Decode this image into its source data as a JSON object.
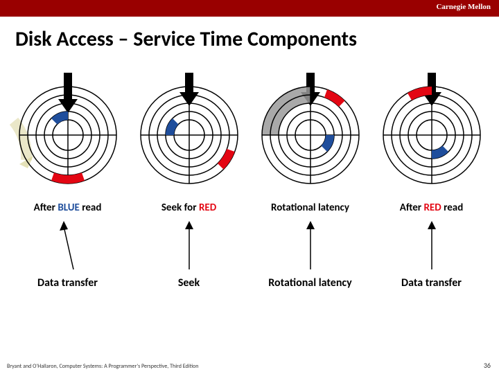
{
  "header": {
    "org": "Carnegie Mellon"
  },
  "title": "Disk Access – Service Time Components",
  "stages": [
    {
      "label_pre": "After ",
      "label_color": "BLUE",
      "label_post": " read",
      "color_class": "blue",
      "bottom": "Data transfer"
    },
    {
      "label_pre": "Seek for ",
      "label_color": "RED",
      "label_post": "",
      "color_class": "red",
      "bottom": "Seek"
    },
    {
      "label_pre": "Rotational latency",
      "label_color": "",
      "label_post": "",
      "color_class": "",
      "bottom": "Rotational latency"
    },
    {
      "label_pre": "After ",
      "label_color": "RED",
      "label_post": " read",
      "color_class": "red",
      "bottom": "Data transfer"
    }
  ],
  "footer": "Bryant and O'Hallaron, Computer Systems: A Programmer's Perspective, Third Edition",
  "page": "36"
}
